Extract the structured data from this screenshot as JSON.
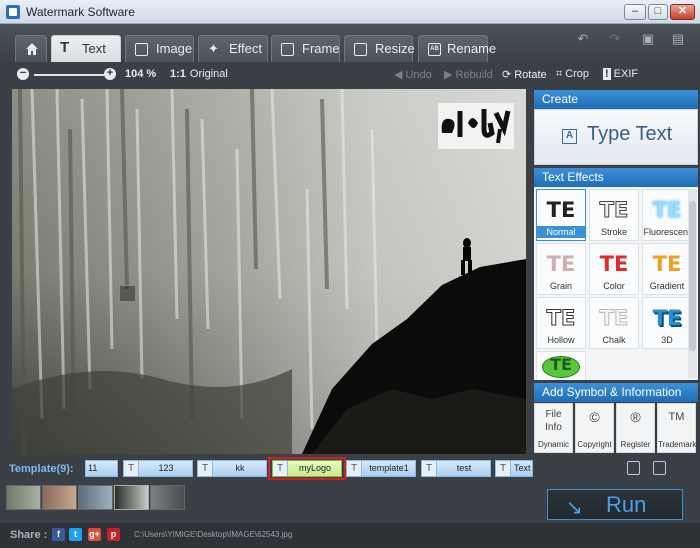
{
  "window": {
    "title": "Watermark Software",
    "minimize": "–",
    "maximize": "□",
    "close": "✕"
  },
  "tabs": [
    {
      "label": "Text",
      "active": true
    },
    {
      "label": "Image"
    },
    {
      "label": "Effect"
    },
    {
      "label": "Frame"
    },
    {
      "label": "Resize"
    },
    {
      "label": "Rename"
    }
  ],
  "toolbar": {
    "zoom": "104 %",
    "original": "Original",
    "undo": "Undo",
    "rebuild": "Rebuild",
    "rotate": "Rotate",
    "crop": "Crop",
    "exif": "EXIF"
  },
  "panel": {
    "create_head": "Create",
    "type_text": "Type Text",
    "type_text_glyph": "A",
    "effects_head": "Text Effects",
    "effects": [
      {
        "glyph": "TE",
        "label": "Normal",
        "color": "#222222"
      },
      {
        "glyph": "TE",
        "label": "Stroke",
        "color": "#e6e6e6"
      },
      {
        "glyph": "TE",
        "label": "Fluorescent",
        "color": "#7fd0f5"
      },
      {
        "glyph": "TE",
        "label": "Grain",
        "color": "#c9a6a6"
      },
      {
        "glyph": "TE",
        "label": "Color",
        "color": "#e02b2b"
      },
      {
        "glyph": "TE",
        "label": "Gradient",
        "color": "#f0a020"
      },
      {
        "glyph": "TE",
        "label": "Hollow",
        "color": "#555555"
      },
      {
        "glyph": "TE",
        "label": "Chalk",
        "color": "#dcdcdc"
      },
      {
        "glyph": "TE",
        "label": "3D",
        "color": "#2a8fd0"
      },
      {
        "glyph": "TE",
        "label": "",
        "color": "#1f7a1f"
      }
    ],
    "symbols_head": "Add Symbol & Information",
    "symbols": [
      {
        "glyph": "File Info",
        "label": "Dynamic"
      },
      {
        "glyph": "©",
        "label": "Copyright"
      },
      {
        "glyph": "®",
        "label": "Register"
      },
      {
        "glyph": "TM",
        "label": "Trademark"
      }
    ]
  },
  "templates": {
    "label": "Template(9):",
    "items": [
      "11",
      "123",
      "kk",
      "myLogo",
      "template1",
      "test",
      "Text E"
    ],
    "active": "myLogo"
  },
  "run": {
    "label": "Run"
  },
  "status": {
    "share": "Share :",
    "path": "C:\\Users\\YIMIGE\\Desktop\\IMAGE\\62543.jpg",
    "social": [
      {
        "glyph": "f",
        "color": "#3b5998"
      },
      {
        "glyph": "t",
        "color": "#1da1f2"
      },
      {
        "glyph": "g+",
        "color": "#dd4b39"
      },
      {
        "glyph": "p",
        "color": "#cb2027"
      }
    ]
  }
}
